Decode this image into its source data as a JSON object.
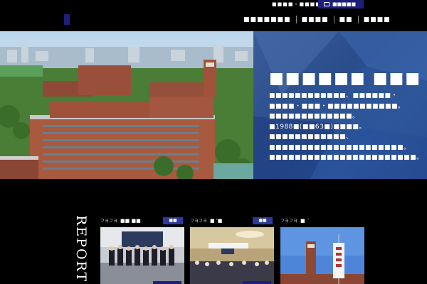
{
  "topbar": {
    "login_label": "■■■■・■■■■■■■",
    "contact_label": "■■■■■"
  },
  "nav": {
    "items": [
      {
        "label": "■■■■■■■"
      },
      {
        "label": "■■■■"
      },
      {
        "label": "■■"
      },
      {
        "label": "■■■■"
      }
    ]
  },
  "hero": {
    "title": "■■■■■■ ■■■",
    "text": "■■■■■■■■■■■■、■■■■■■・■■■■・■■■・■■■■■■■■■■■。■■■■■■■■■■■■■。■1988■(■■63■)■■■■。■■■■■■■■■■■■、■■■■■■■■■■■■■■■■■■■■■。■■■■■■■■■■■■■■■■■■■■■■■。"
  },
  "report": {
    "label": "REPORT"
  },
  "cards": [
    {
      "date": "フヨフヨ",
      "title": "■■ ■■",
      "tag": "■■"
    },
    {
      "date": "フヨフヨ",
      "title": "■ '■",
      "tag": "■■"
    },
    {
      "date": "フヨフヨ",
      "title": "■ ′′",
      "tag": "■■"
    }
  ],
  "colors": {
    "background": "#000000",
    "brand_navy": "#1e1f7a",
    "panel_blue": "#2a4d8c",
    "tag_blue": "#2d3a9c"
  },
  "icons": {
    "contact": "mail-icon",
    "logo": "logo-mark"
  }
}
